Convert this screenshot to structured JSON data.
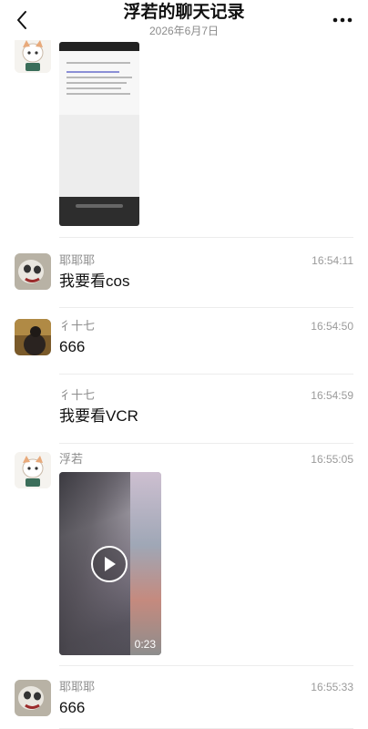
{
  "header": {
    "title": "浮若的聊天记录",
    "date": "2026年6月7日",
    "back_icon": "chevron-left-icon",
    "more_icon": "more-dots-icon"
  },
  "messages": [
    {
      "sender": "",
      "time": "",
      "type": "image",
      "avatar": "fox-avatar"
    },
    {
      "sender": "耶耶耶",
      "time": "16:54:11",
      "text": "我要看cos",
      "avatar": "skull-avatar"
    },
    {
      "sender": "彳十七",
      "time": "16:54:50",
      "text": "666",
      "avatar": "dark-photo-avatar"
    },
    {
      "sender": "彳十七",
      "time": "16:54:59",
      "text": "我要看VCR"
    },
    {
      "sender": "浮若",
      "time": "16:55:05",
      "type": "video",
      "duration": "0:23",
      "avatar": "fox-avatar"
    },
    {
      "sender": "耶耶耶",
      "time": "16:55:33",
      "text": "666",
      "avatar": "skull-avatar"
    }
  ],
  "colors": {
    "text_primary": "#111111",
    "text_secondary": "#8c8c8c",
    "divider": "#ececec"
  }
}
